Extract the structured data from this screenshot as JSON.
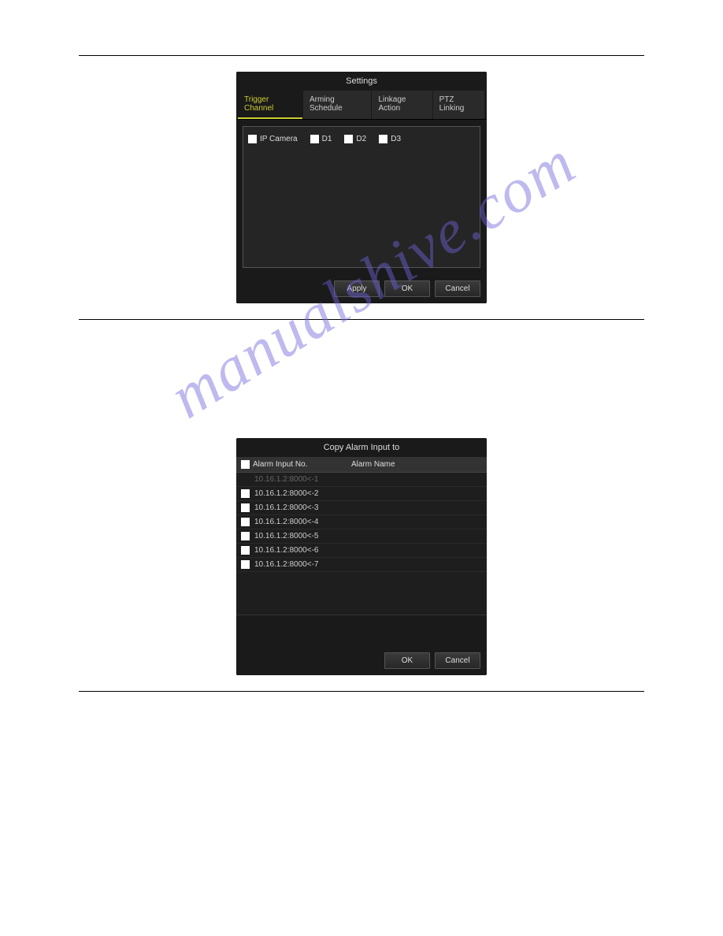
{
  "watermark": "manualshive.com",
  "settings_dialog": {
    "title": "Settings",
    "tabs": [
      "Trigger Channel",
      "Arming Schedule",
      "Linkage Action",
      "PTZ Linking"
    ],
    "active_tab_index": 0,
    "checkbox_master": "IP Camera",
    "checkboxes": [
      "D1",
      "D2",
      "D3"
    ],
    "buttons": {
      "apply": "Apply",
      "ok": "OK",
      "cancel": "Cancel"
    }
  },
  "copy_dialog": {
    "title": "Copy Alarm Input to",
    "columns": [
      "Alarm Input No.",
      "Alarm Name"
    ],
    "rows": [
      {
        "no": "10.16.1.2:8000<-1",
        "name": "",
        "dim": true
      },
      {
        "no": "10.16.1.2:8000<-2",
        "name": ""
      },
      {
        "no": "10.16.1.2:8000<-3",
        "name": ""
      },
      {
        "no": "10.16.1.2:8000<-4",
        "name": ""
      },
      {
        "no": "10.16.1.2:8000<-5",
        "name": ""
      },
      {
        "no": "10.16.1.2:8000<-6",
        "name": ""
      },
      {
        "no": "10.16.1.2:8000<-7",
        "name": ""
      }
    ],
    "buttons": {
      "ok": "OK",
      "cancel": "Cancel"
    }
  }
}
